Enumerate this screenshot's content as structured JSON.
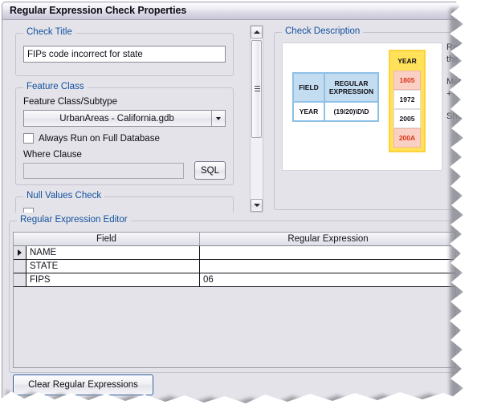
{
  "window": {
    "title": "Regular Expression Check Properties"
  },
  "check_title": {
    "group_label": "Check Title",
    "value": "FIPs code incorrect for state"
  },
  "feature_class": {
    "group_label": "Feature Class",
    "subtype_label": "Feature Class/Subtype",
    "combo_value": "UrbanAreas -  California.gdb",
    "combo_arrow_icon": "chevron-down-icon",
    "always_run_label": "Always Run on Full Database",
    "always_run_checked": false,
    "where_clause_label": "Where Clause",
    "where_clause_value": "",
    "sql_button_label": "SQL"
  },
  "null_values": {
    "group_label": "Null Values Check"
  },
  "check_description": {
    "group_label": "Check Description",
    "diagram": {
      "left_table": {
        "headers": [
          "FIELD",
          "REGULAR EXPRESSION"
        ],
        "row": [
          "YEAR",
          "(19/20)\\D\\D"
        ],
        "header_bg": "#c3dcf0",
        "border": "#8fc0e6",
        "cell_bg": "#ffffff"
      },
      "right_table": {
        "title": "YEAR",
        "title_bg": "#ffe15a",
        "border": "#ffd23a",
        "rows": [
          {
            "value": "1805",
            "bg": "#fbd0c4",
            "color": "#d6351c"
          },
          {
            "value": "1972",
            "bg": "#ffffff",
            "color": "#101018"
          },
          {
            "value": "2005",
            "bg": "#ffffff",
            "color": "#101018"
          },
          {
            "value": "200A",
            "bg": "#fbd0c4",
            "color": "#d6351c"
          }
        ]
      }
    },
    "side_text": [
      "Return",
      "the re",
      "Metac",
      "+? \"",
      "Short"
    ]
  },
  "regex_editor": {
    "group_label": "Regular Expression Editor",
    "columns": [
      "Field",
      "Regular Expression"
    ],
    "rows": [
      {
        "selected": true,
        "field": "NAME",
        "expression": ""
      },
      {
        "selected": false,
        "field": "STATE",
        "expression": ""
      },
      {
        "selected": false,
        "field": "FIPS",
        "expression": "06"
      }
    ],
    "row_selector_icon": "row-pointer-icon"
  },
  "footer": {
    "clear_button_label": "Clear Regular Expressions"
  },
  "scrollbar": {
    "up_icon": "scroll-up-arrow-icon",
    "down_icon": "scroll-down-arrow-icon",
    "grip_icon": "scrollbar-grip-icon"
  }
}
